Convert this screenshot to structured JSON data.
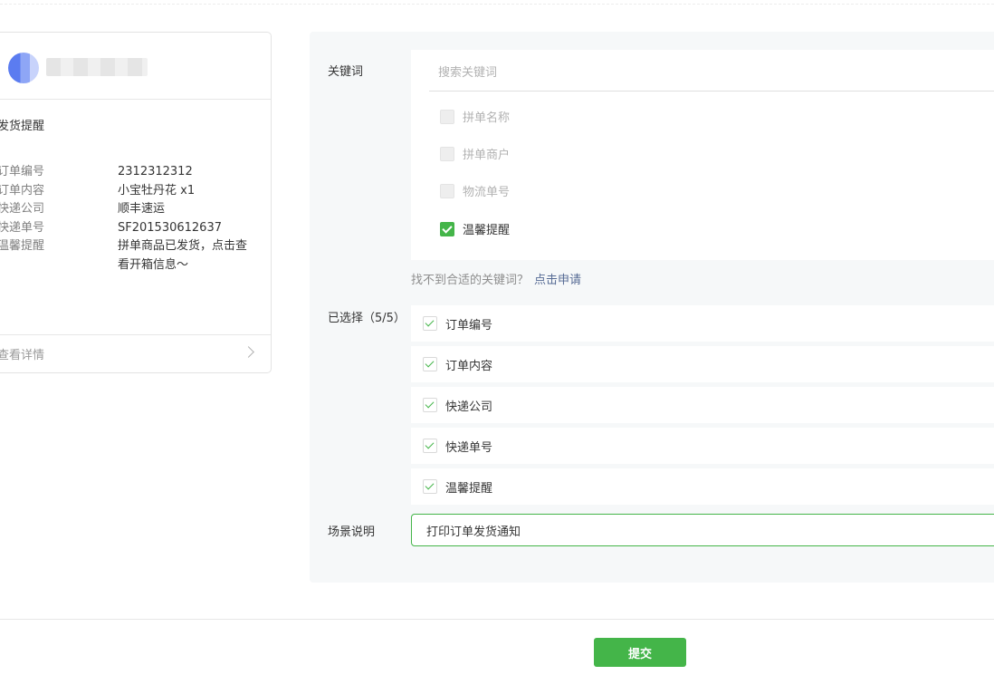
{
  "preview": {
    "title": "发货提醒",
    "fields": [
      {
        "key": "订单编号",
        "value": "2312312312"
      },
      {
        "key": "订单内容",
        "value": "小宝牡丹花 x1"
      },
      {
        "key": "快递公司",
        "value": "顺丰速运"
      },
      {
        "key": "快递单号",
        "value": "SF201530612637"
      },
      {
        "key": "温馨提醒",
        "value": "拼单商品已发货，点击查看开箱信息～"
      }
    ],
    "footer_link": "查看详情"
  },
  "keywords": {
    "label": "关键词",
    "search_placeholder": "搜索关键词",
    "options": [
      {
        "label": "拼单名称",
        "state": "disabled"
      },
      {
        "label": "拼单商户",
        "state": "disabled"
      },
      {
        "label": "物流单号",
        "state": "disabled"
      },
      {
        "label": "温馨提醒",
        "state": "checked"
      }
    ],
    "hint_text": "找不到合适的关键词？",
    "hint_link": "点击申请"
  },
  "selected": {
    "label": "已选择（5/5）",
    "items": [
      "订单编号",
      "订单内容",
      "快递公司",
      "快递单号",
      "温馨提醒"
    ]
  },
  "scene": {
    "label": "场景说明",
    "value": "打印订单发货通知"
  },
  "submit_label": "提交",
  "colors": {
    "accent": "#44b549",
    "link": "#576b95",
    "panel_bg": "#f6f8f9"
  }
}
